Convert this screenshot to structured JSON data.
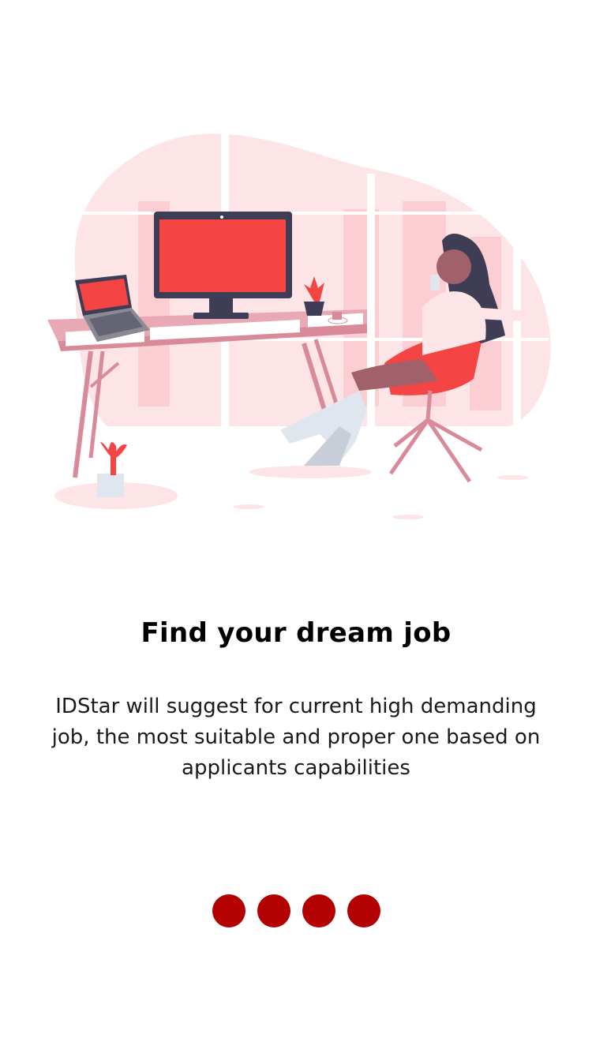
{
  "onboarding": {
    "title": "Find your dream job",
    "description": "IDStar will suggest for current high demanding job, the most suitable and proper one based on applicants capabilities",
    "pager": {
      "count": 4,
      "dot_color": "#b30000",
      "dots": [
        "page 1",
        "page 2",
        "page 3",
        "page 4"
      ]
    }
  },
  "colors": {
    "accent": "#f44444",
    "pink_light": "#fde4e6",
    "pink_mid": "#d98a98",
    "dark": "#3f3d56"
  },
  "illustration": {
    "icon": "woman-at-desk-illustration"
  }
}
